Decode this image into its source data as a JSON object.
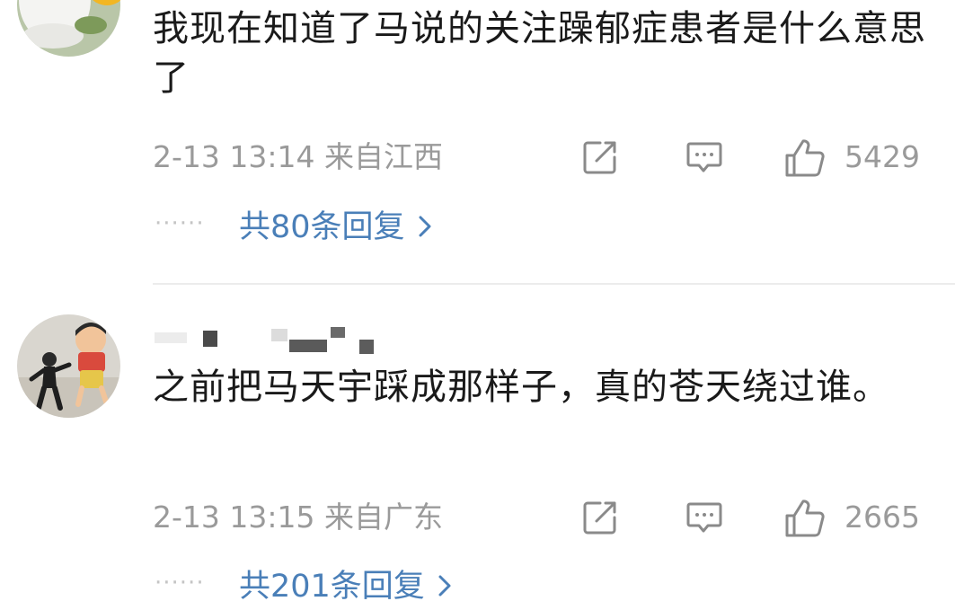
{
  "comments": [
    {
      "username": "",
      "text": "我现在知道了马说的关注躁郁症患者是什么意思了",
      "time_location": "2-13 13:14 来自江西",
      "likes": "5429",
      "replies_label": "共80条回复",
      "reply_dots": "······",
      "icons": [
        "share-icon",
        "comment-icon",
        "like-icon",
        "chevron-right-icon"
      ]
    },
    {
      "username": "",
      "text": "之前把马天宇踩成那样子，真的苍天绕过谁。",
      "time_location": "2-13 13:15 来自广东",
      "likes": "2665",
      "replies_label": "共201条回复",
      "reply_dots": "······",
      "icons": [
        "share-icon",
        "comment-icon",
        "like-icon",
        "chevron-right-icon"
      ]
    }
  ],
  "colors": {
    "text": "#1a1a1a",
    "meta": "#9a9a9a",
    "link": "#4a7fb8",
    "divider": "#ececec"
  }
}
